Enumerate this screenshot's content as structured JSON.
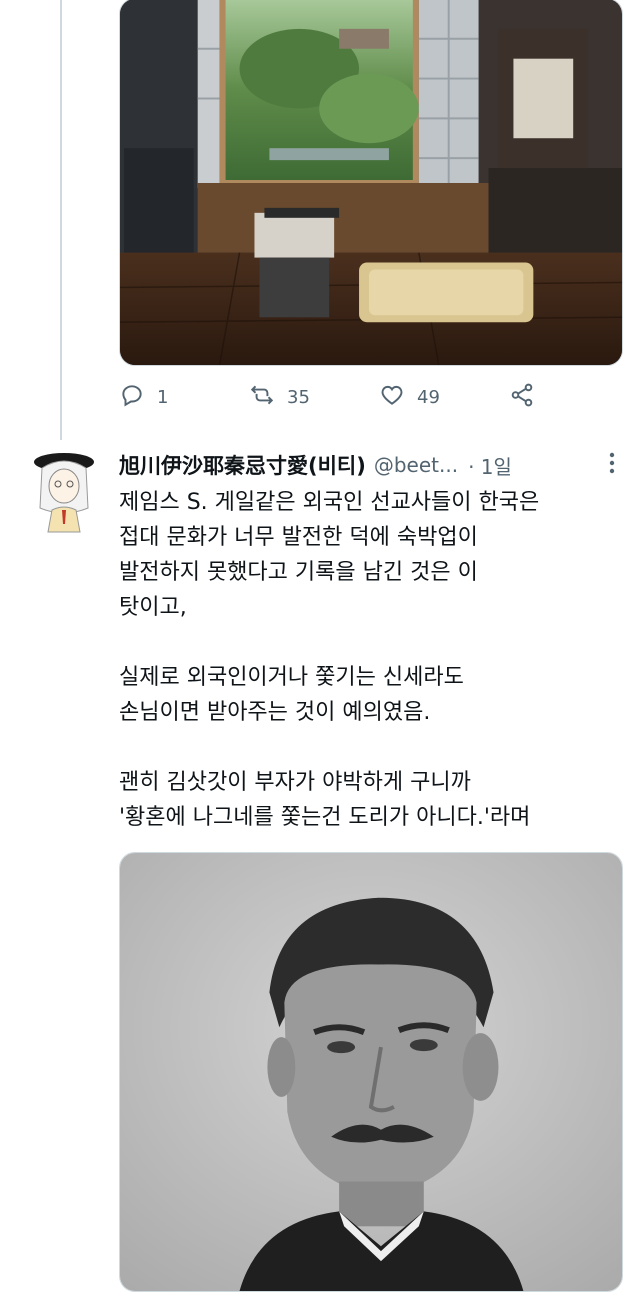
{
  "prev_tweet": {
    "actions": {
      "reply_count": "1",
      "retweet_count": "35",
      "like_count": "49"
    },
    "icons": [
      "reply-icon",
      "retweet-icon",
      "like-icon",
      "share-icon"
    ]
  },
  "tweet": {
    "display_name": "旭川伊沙耶秦忌寸愛(비티)",
    "handle": "@beet...",
    "time": "· 1일",
    "text": "제임스 S. 게일같은 외국인 선교사들이 한국은\n접대 문화가 너무 발전한 덕에 숙박업이\n발전하지 못했다고 기록을 남긴 것은 이\n탓이고,\n\n실제로 외국인이거나 쫓기는 신세라도\n손님이면 받아주는 것이 예의였음.\n\n괜히 김삿갓이 부자가 야박하게 구니까\n'황혼에 나그네를 쫓는건 도리가 아니다.'라며"
  },
  "colors": {
    "text_primary": "#0f1419",
    "text_secondary": "#536471",
    "divider": "#cfd9de",
    "background": "#ffffff"
  }
}
